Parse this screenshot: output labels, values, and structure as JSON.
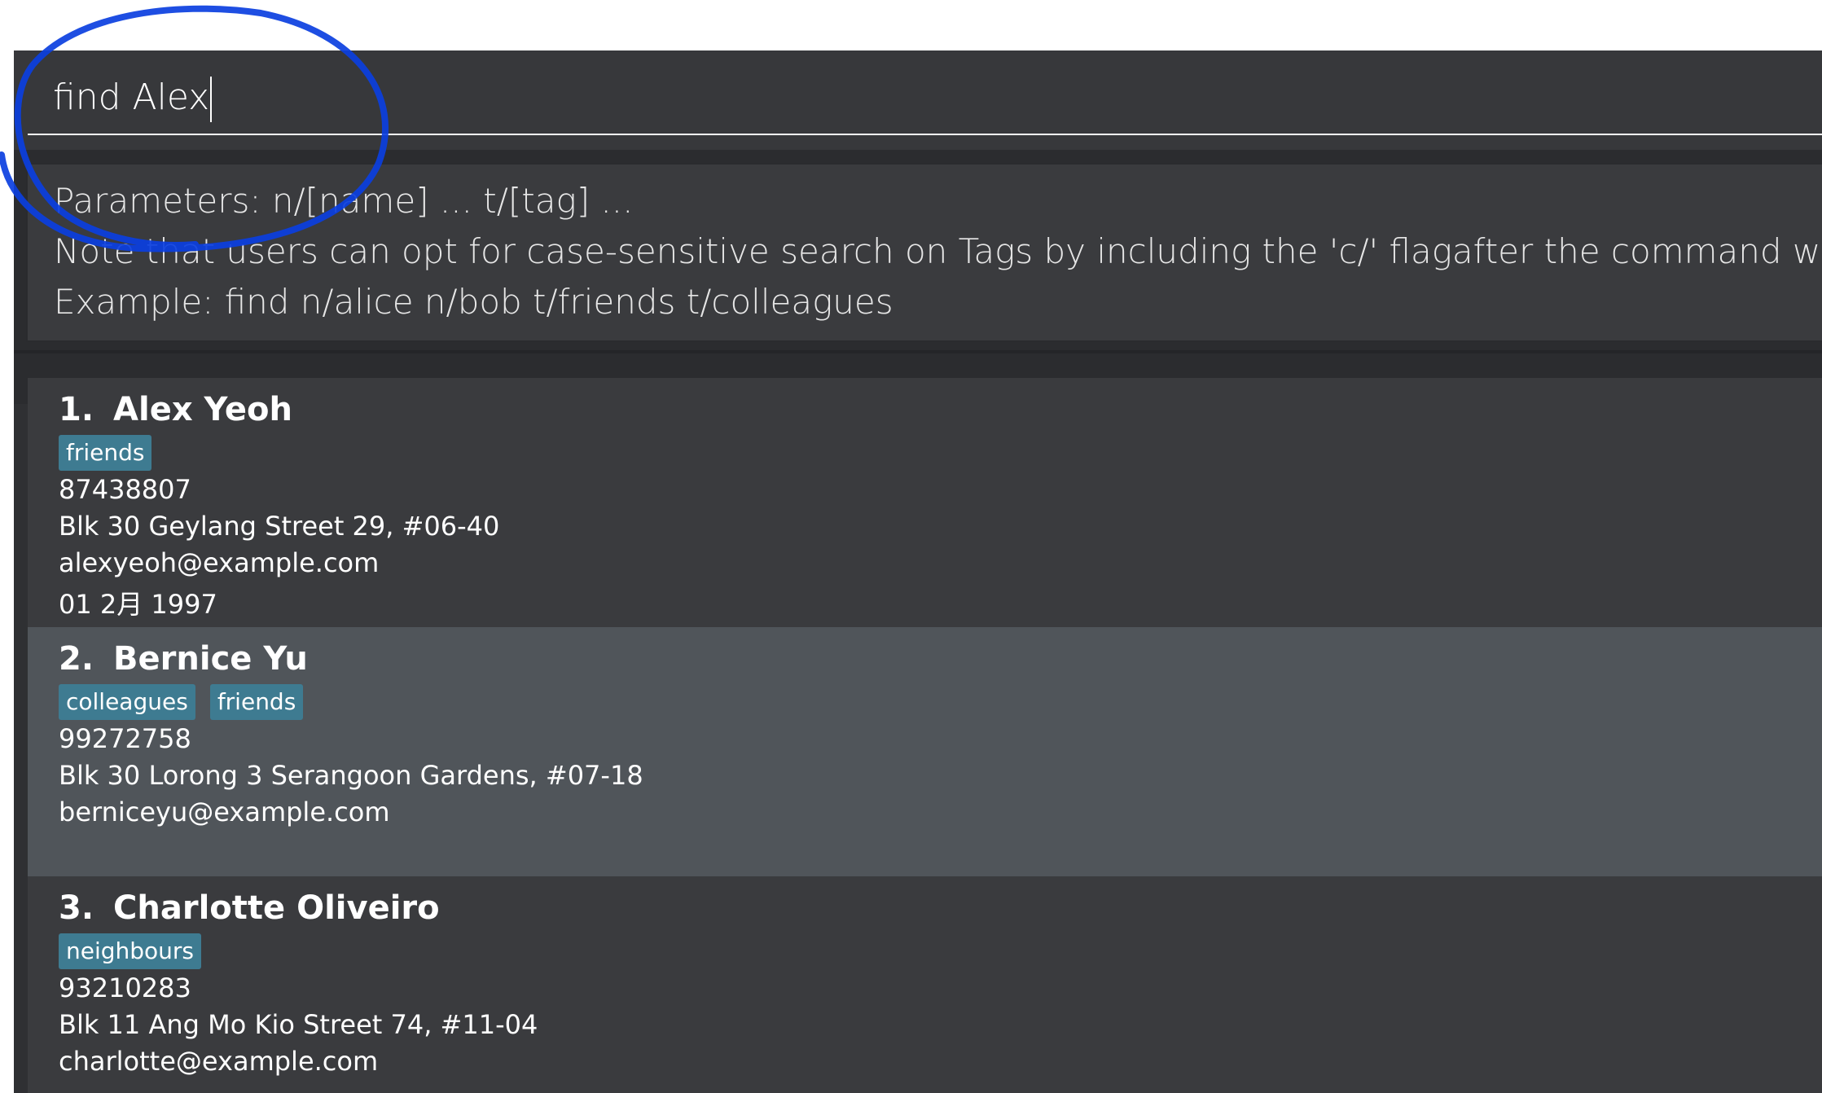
{
  "command_box": {
    "value": "find Alex"
  },
  "result_display": {
    "lines": [
      "Parameters: n/[name] ... t/[tag] ...",
      "Note that users can opt for case-sensitive search on Tags by including the 'c/' flagafter the command word",
      "Example: find n/alice n/bob t/friends t/colleagues"
    ]
  },
  "persons": [
    {
      "index": "1.",
      "name": "Alex Yeoh",
      "tags": [
        "friends"
      ],
      "phone": "87438807",
      "address": "Blk 30 Geylang Street 29, #06-40",
      "email": "alexyeoh@example.com",
      "birthday": "01 2月 1997"
    },
    {
      "index": "2.",
      "name": "Bernice Yu",
      "tags": [
        "colleagues",
        "friends"
      ],
      "phone": "99272758",
      "address": "Blk 30 Lorong 3 Serangoon Gardens, #07-18",
      "email": "berniceyu@example.com"
    },
    {
      "index": "3.",
      "name": "Charlotte Oliveiro",
      "tags": [
        "neighbours"
      ],
      "phone": "93210283",
      "address": "Blk 11 Ang Mo Kio Street 74, #11-04",
      "email": "charlotte@example.com"
    }
  ],
  "colors": {
    "background": "#2f3033",
    "card": "#3a3b3e",
    "card_selected": "#50555a",
    "tag": "#3e7b91",
    "annotation": "#0b3fe0"
  }
}
